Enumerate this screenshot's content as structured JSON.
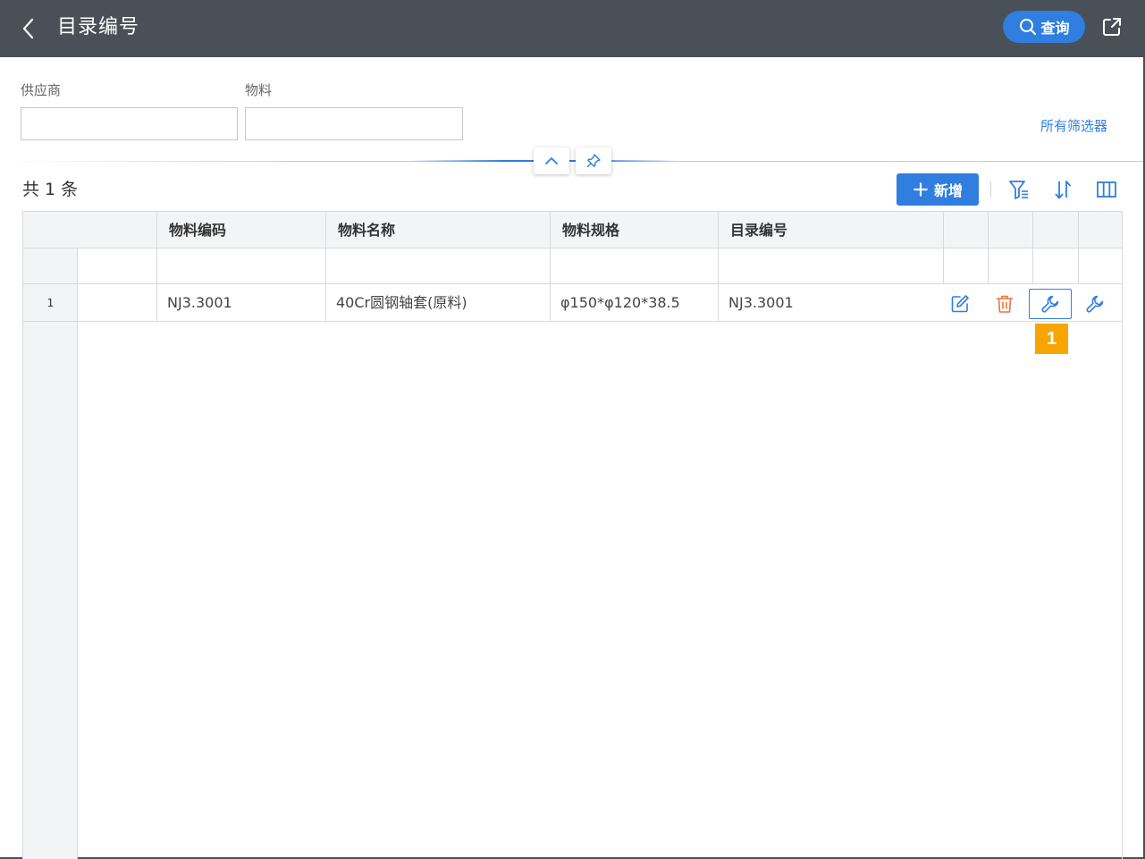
{
  "header": {
    "title": "目录编号",
    "query_label": "查询"
  },
  "filters": {
    "supplier_label": "供应商",
    "supplier_value": "",
    "material_label": "物料",
    "material_value": "",
    "all_filters_label": "所有筛选器"
  },
  "toolbar": {
    "total_text": "共 1 条",
    "add_label": "新增"
  },
  "table": {
    "columns": [
      "物料编码",
      "物料名称",
      "物料规格",
      "目录编号"
    ],
    "rows": [
      {
        "index": "1",
        "material_code": "NJ3.3001",
        "material_name": "40Cr圆钢轴套(原料)",
        "material_spec": "φ150*φ120*38.5",
        "catalog_no": "NJ3.3001"
      }
    ]
  },
  "annotation": {
    "badge": "1"
  },
  "colors": {
    "header_bg": "#4a5058",
    "accent": "#2f7ee0",
    "delete": "#f07040",
    "badge": "#f7a500"
  },
  "icons": [
    "back-icon",
    "search-icon",
    "export-icon",
    "chevron-up-icon",
    "pin-icon",
    "plus-icon",
    "filter-icon",
    "sort-icon",
    "columns-icon",
    "edit-icon",
    "delete-icon",
    "wrench-icon"
  ]
}
